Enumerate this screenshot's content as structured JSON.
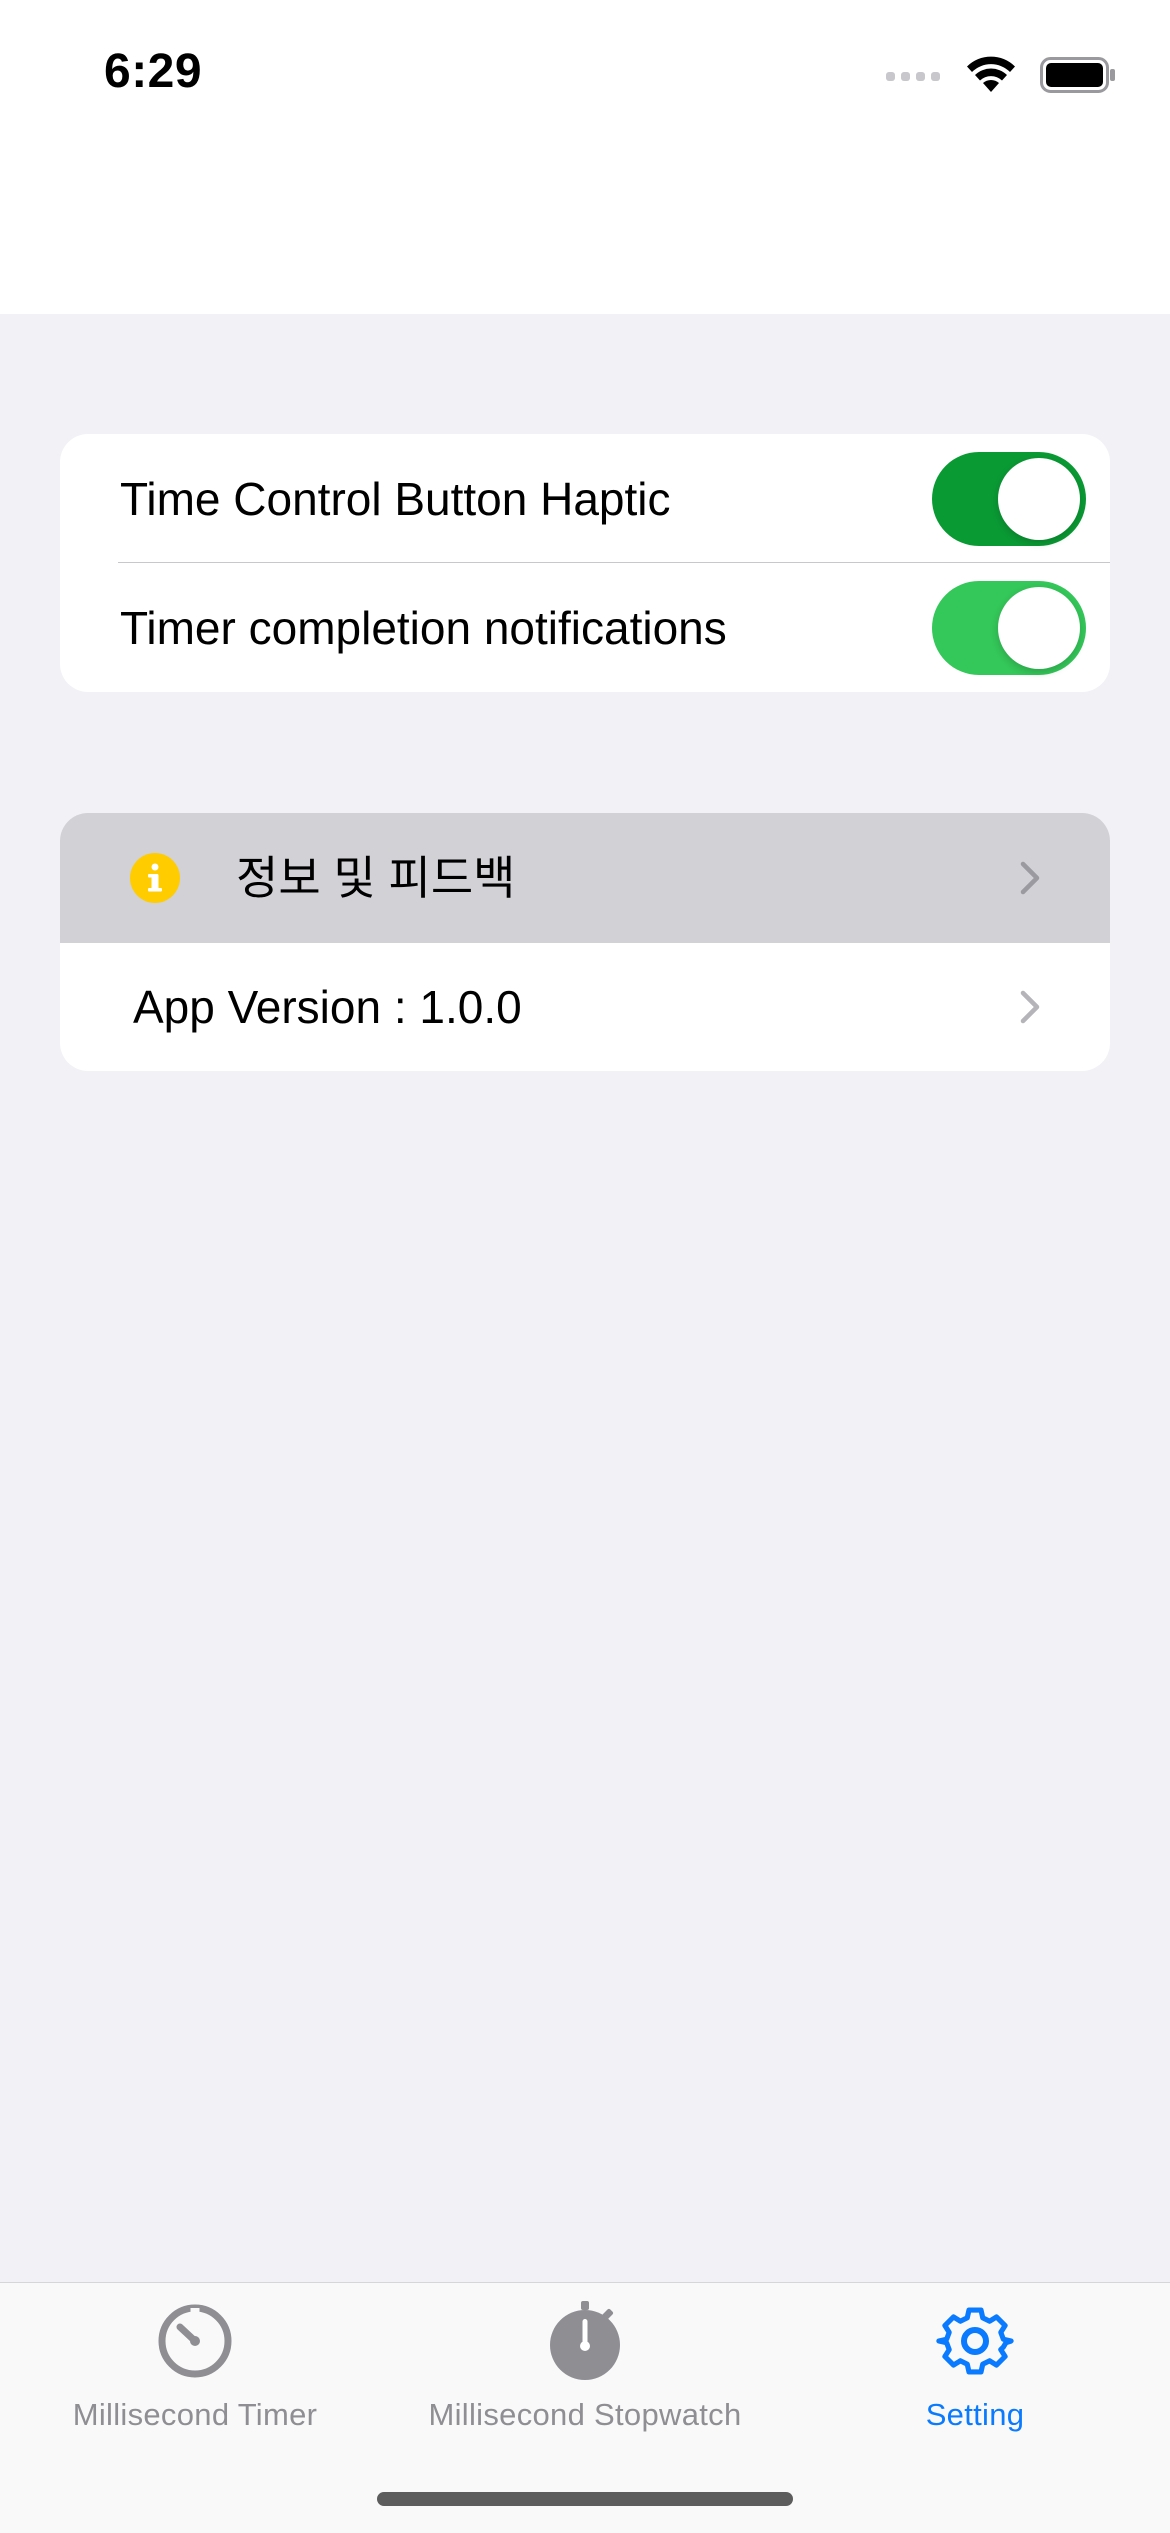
{
  "status_bar": {
    "time": "6:29"
  },
  "settings": {
    "toggles": [
      {
        "label": "Time Control Button Haptic",
        "on": true,
        "color": "#0a9a34"
      },
      {
        "label": "Timer completion notifications",
        "on": true,
        "color": "#34c759"
      }
    ],
    "links": [
      {
        "label": "정보 및 피드백",
        "icon": "info-circle-icon",
        "icon_color": "#ffcc00",
        "highlighted": true
      },
      {
        "label": "App Version : 1.0.0"
      }
    ]
  },
  "tab_bar": {
    "tabs": [
      {
        "label": "Millisecond Timer",
        "icon": "timer-icon",
        "active": false
      },
      {
        "label": "Millisecond Stopwatch",
        "icon": "stopwatch-icon",
        "active": false
      },
      {
        "label": "Setting",
        "icon": "gear-icon",
        "active": true
      }
    ],
    "active_color": "#0a7aff",
    "inactive_color": "#8e8e93"
  }
}
